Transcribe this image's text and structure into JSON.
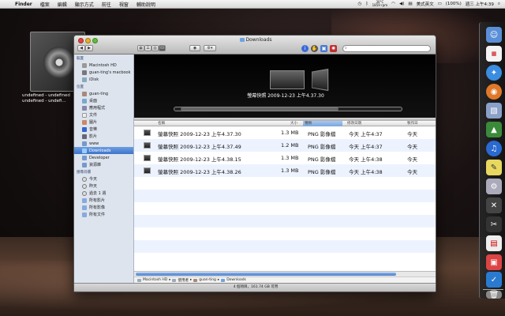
{
  "menubar": {
    "items": [
      "Finder",
      "檔案",
      "編輯",
      "顯示方式",
      "前往",
      "視窗",
      "輔助說明"
    ],
    "temp_top": "30°C",
    "temp_bottom": "1859 rpm",
    "input_method": "美式英文",
    "battery": "(100%)",
    "clock": "週三 上午4:39"
  },
  "desktop": {
    "dvd_label_line1": "undefined - undefined",
    "dvd_label_line2": "undefined - undefi..."
  },
  "window": {
    "title": "Downloads",
    "search_placeholder": ""
  },
  "sidebar": {
    "groups": [
      {
        "header": "裝置",
        "items": [
          {
            "label": "Macintosh HD",
            "icon": "hd-icon"
          },
          {
            "label": "guan-ting's macbook",
            "icon": "computer-icon"
          },
          {
            "label": "iDisk",
            "icon": "idisk-icon"
          }
        ]
      },
      {
        "header": "位置",
        "items": [
          {
            "label": "guan-ting",
            "icon": "home-icon"
          },
          {
            "label": "桌面",
            "icon": "desktop-icon"
          },
          {
            "label": "應用程式",
            "icon": "apps-icon"
          },
          {
            "label": "文件",
            "icon": "documents-icon"
          },
          {
            "label": "圖片",
            "icon": "pictures-icon"
          },
          {
            "label": "音樂",
            "icon": "music-icon"
          },
          {
            "label": "影片",
            "icon": "movies-icon"
          },
          {
            "label": "www",
            "icon": "folder-icon"
          },
          {
            "label": "Downloads",
            "icon": "downloads-icon",
            "selected": true
          },
          {
            "label": "Developer",
            "icon": "folder-icon"
          },
          {
            "label": "資源庫",
            "icon": "library-icon"
          }
        ]
      },
      {
        "header": "搜尋目標",
        "items": [
          {
            "label": "今天",
            "icon": "clock-icon"
          },
          {
            "label": "昨天",
            "icon": "clock-icon"
          },
          {
            "label": "過去 1 週",
            "icon": "clock-icon"
          },
          {
            "label": "所有影片",
            "icon": "smart-folder-icon"
          },
          {
            "label": "所有影像",
            "icon": "smart-folder-icon"
          },
          {
            "label": "所有文件",
            "icon": "smart-folder-icon"
          }
        ]
      }
    ]
  },
  "coverflow": {
    "selected_title": "螢幕快照 2009-12-23 上午4.37.30"
  },
  "list": {
    "columns": {
      "name": "名稱",
      "size": "大小",
      "kind": "種類",
      "modified": "修改日期",
      "created": "製作日"
    },
    "rows": [
      {
        "name": "螢幕快照 2009-12-23 上午4.37.30",
        "size": "1.3 MB",
        "kind": "PNG 影像檔",
        "modified": "今天 上午4:37",
        "created": "今天"
      },
      {
        "name": "螢幕快照 2009-12-23 上午4.37.49",
        "size": "1.2 MB",
        "kind": "PNG 影像檔",
        "modified": "今天 上午4:37",
        "created": "今天"
      },
      {
        "name": "螢幕快照 2009-12-23 上午4.38.15",
        "size": "1.3 MB",
        "kind": "PNG 影像檔",
        "modified": "今天 上午4:38",
        "created": "今天"
      },
      {
        "name": "螢幕快照 2009-12-23 上午4.38.26",
        "size": "1.3 MB",
        "kind": "PNG 影像檔",
        "modified": "今天 上午4:38",
        "created": "今天"
      }
    ]
  },
  "pathbar": [
    "Macintosh HD",
    "使用者",
    "guan-ting",
    "Downloads"
  ],
  "status": "4 個項目，161.74 GB 可用",
  "colors": {
    "selection": "#3d74c9",
    "sidebar_bg": "#dde4ee",
    "row_alt": "#edf3fe"
  }
}
